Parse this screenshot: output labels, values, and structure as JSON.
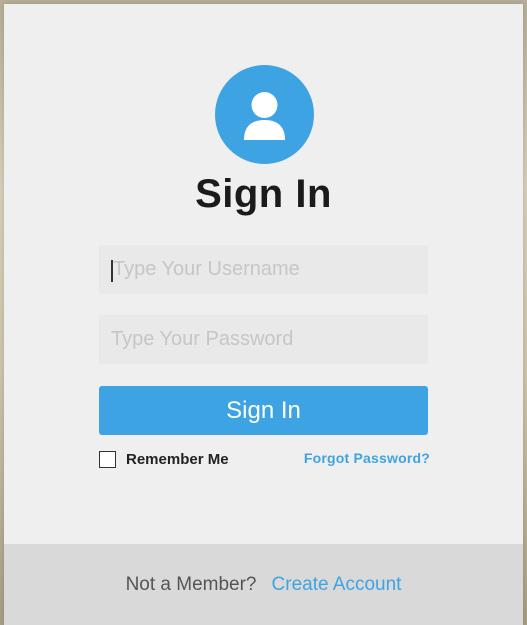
{
  "header": {
    "title": "Sign In",
    "avatar_icon": "user-icon"
  },
  "form": {
    "username": {
      "value": "",
      "placeholder": "Type Your Username"
    },
    "password": {
      "value": "",
      "placeholder": "Type Your Password"
    },
    "submit_label": "Sign In",
    "remember_label": "Remember Me",
    "remember_checked": false,
    "forgot_label": "Forgot Password?"
  },
  "footer": {
    "prompt": "Not a Member?",
    "link_label": "Create Account"
  },
  "colors": {
    "accent": "#3ea3e3",
    "card": "#efefef",
    "footer": "#d9d9d9"
  }
}
